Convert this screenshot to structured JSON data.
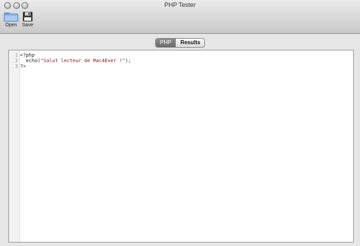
{
  "window": {
    "title": "PHP Tester"
  },
  "toolbar": {
    "open_label": "Open",
    "save_label": "Save"
  },
  "tabs": [
    {
      "label": "PHP",
      "active": true
    },
    {
      "label": "Results",
      "active": false
    }
  ],
  "editor": {
    "lines": [
      {
        "num": "1",
        "text": "<?php"
      },
      {
        "num": "2",
        "pre": "  echo(",
        "str": "\"Salut lecteur de Mac4Ever !\"",
        "post": ");"
      },
      {
        "num": "3",
        "text": "?>"
      }
    ]
  },
  "colors": {
    "string": "#7a1b1b",
    "active_tab": "#7a7a7a"
  }
}
